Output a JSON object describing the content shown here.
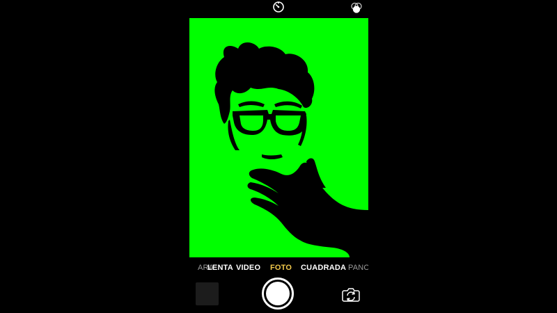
{
  "toolbar": {
    "timer_icon": "timer-icon",
    "filters_icon": "filters-icon"
  },
  "viewfinder": {
    "background_color": "#00ff00",
    "subject_color": "#000000"
  },
  "modes": {
    "items": [
      {
        "label": "ARA",
        "state": "clipped"
      },
      {
        "label": "LENTA",
        "state": "inactive"
      },
      {
        "label": "VIDEO",
        "state": "inactive"
      },
      {
        "label": "FOTO",
        "state": "active"
      },
      {
        "label": "CUADRADA",
        "state": "inactive"
      },
      {
        "label": "PANO",
        "state": "clipped"
      }
    ],
    "active_color": "#f2c94c"
  },
  "controls": {
    "thumbnail_icon": "last-photo-thumbnail",
    "shutter_icon": "shutter-button",
    "flip_icon": "camera-flip-icon"
  }
}
